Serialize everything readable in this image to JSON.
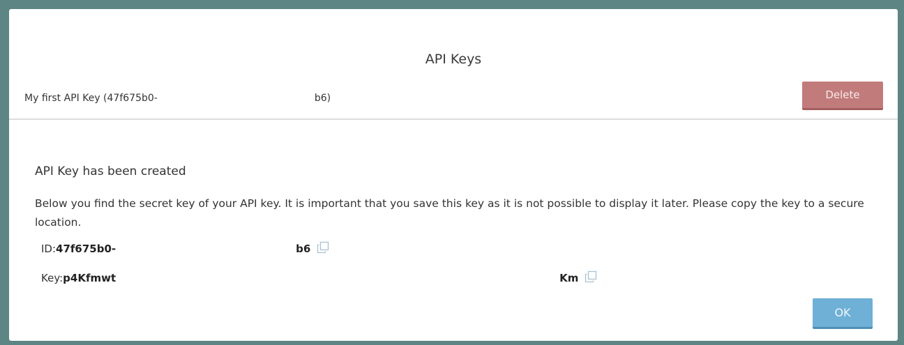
{
  "dialog": {
    "title": "API Keys"
  },
  "key_row": {
    "name_prefix": "My first API Key (47f675b0-",
    "name_suffix": "b6)",
    "delete_label": "Delete"
  },
  "created": {
    "heading": "API Key has been created",
    "description": "Below you find the secret key of your API key. It is important that you save this key as it is not possible to display it later. Please copy the key to a secure location.",
    "id_label": "ID:",
    "id_prefix": "47f675b0-",
    "id_suffix": "b6",
    "key_label": "Key:",
    "key_prefix": "p4Kfmwt",
    "key_suffix": "Km",
    "ok_label": "OK"
  },
  "colors": {
    "backdrop": "#5c8584",
    "delete_button": "#c27b7b",
    "ok_button": "#6fb0d6"
  },
  "icons": {
    "copy": "copy-icon"
  }
}
